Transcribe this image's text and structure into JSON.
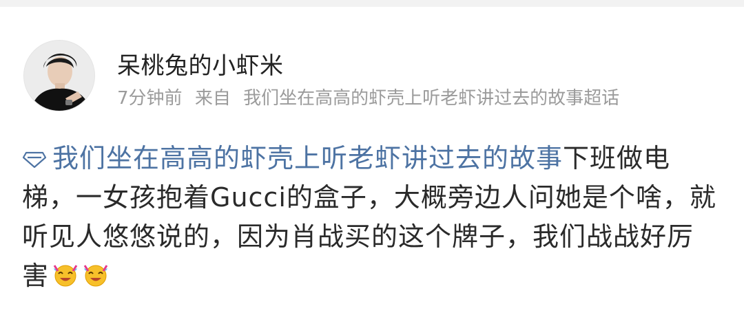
{
  "post": {
    "author": "呆桃兔的小虾米",
    "time": "7分钟前",
    "source_prefix": "来自",
    "source": "我们坐在高高的虾壳上听老虾讲过去的故事超话",
    "topic_icon": "diamond-link-icon",
    "topic": "我们坐在高高的虾壳上听老虾讲过去的故事",
    "body": "下班做电梯，一女孩抱着Gucci的盒子，大概旁边人问她是个啥，就听见人悠悠说的，因为肖战买的这个牌子，我们战战好厉害",
    "emojis": [
      "laugh-cry-emoji",
      "laugh-cry-emoji"
    ]
  },
  "colors": {
    "topic": "#4d73a3",
    "meta": "#9b9b9b",
    "text": "#2a2a2a"
  }
}
